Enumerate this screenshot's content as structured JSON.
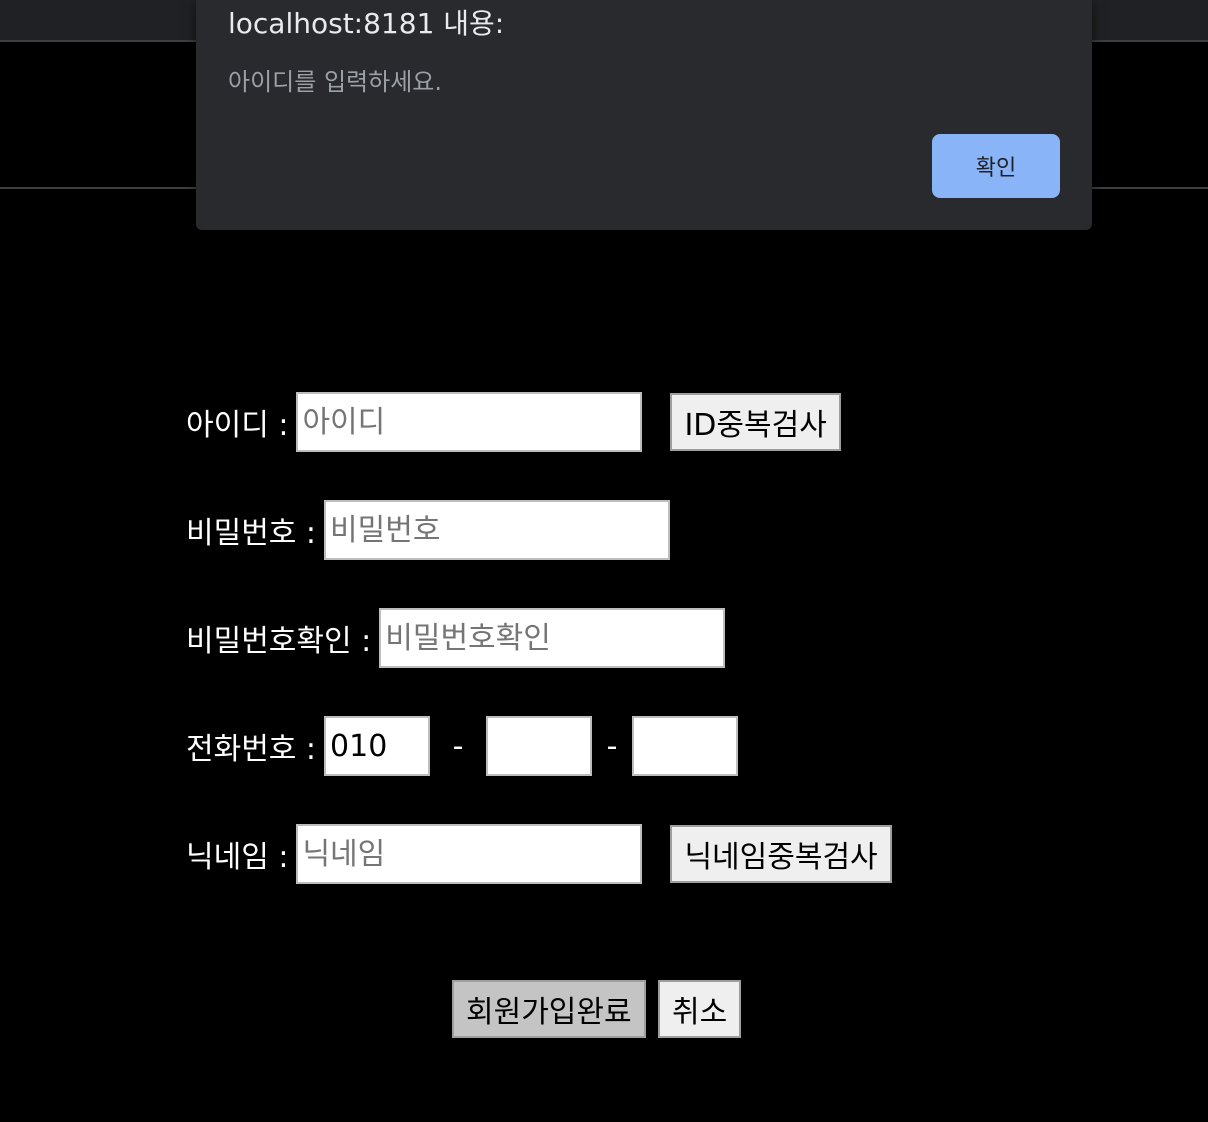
{
  "dialog": {
    "title": "localhost:8181 내용:",
    "message": "아이디를 입력하세요.",
    "ok_label": "확인"
  },
  "form": {
    "id": {
      "label": "아이디 :",
      "placeholder": "아이디",
      "check_label": "ID중복검사"
    },
    "password": {
      "label": "비밀번호 :",
      "placeholder": "비밀번호"
    },
    "password_confirm": {
      "label": "비밀번호확인 :",
      "placeholder": "비밀번호확인"
    },
    "phone": {
      "label": "전화번호 :",
      "part1_value": "010",
      "part2_value": "",
      "part3_value": "",
      "separator": "-"
    },
    "nickname": {
      "label": "닉네임 :",
      "placeholder": "닉네임",
      "check_label": "닉네임중복검사"
    },
    "submit_label": "회원가입완료",
    "cancel_label": "취소"
  },
  "colors": {
    "dialog_bg": "#292a2d",
    "dialog_button": "#8ab4f8",
    "page_bg": "#000000"
  }
}
